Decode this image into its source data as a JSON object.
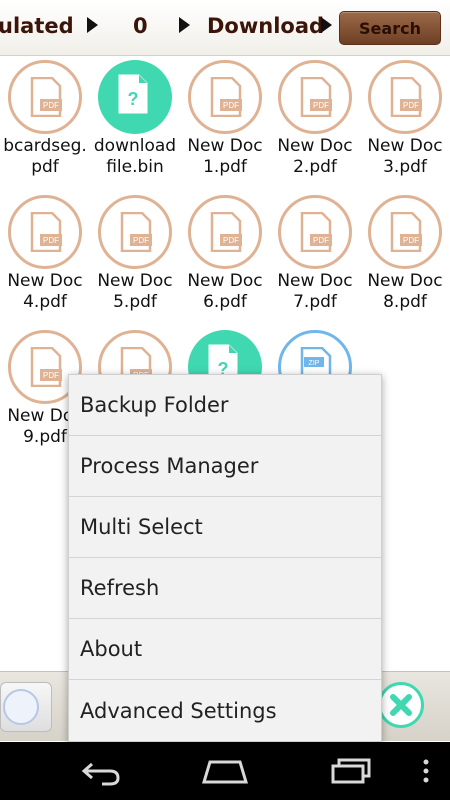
{
  "breadcrumb": {
    "items": [
      "ulated",
      "0",
      "Download"
    ],
    "search_label": "Search"
  },
  "files": [
    {
      "name_line1": "bcardseg.",
      "name_line2": "pdf",
      "type": "pdf-icon"
    },
    {
      "name_line1": "download",
      "name_line2": "file.bin",
      "type": "bin-icon"
    },
    {
      "name_line1": "New Doc",
      "name_line2": "1.pdf",
      "type": "pdf-icon"
    },
    {
      "name_line1": "New Doc",
      "name_line2": "2.pdf",
      "type": "pdf-icon"
    },
    {
      "name_line1": "New Doc",
      "name_line2": "3.pdf",
      "type": "pdf-icon"
    },
    {
      "name_line1": "New Doc",
      "name_line2": "4.pdf",
      "type": "pdf-icon"
    },
    {
      "name_line1": "New Doc",
      "name_line2": "5.pdf",
      "type": "pdf-icon"
    },
    {
      "name_line1": "New Doc",
      "name_line2": "6.pdf",
      "type": "pdf-icon"
    },
    {
      "name_line1": "New Doc",
      "name_line2": "7.pdf",
      "type": "pdf-icon"
    },
    {
      "name_line1": "New Doc",
      "name_line2": "8.pdf",
      "type": "pdf-icon"
    },
    {
      "name_line1": "New Doc",
      "name_line2": "9.pdf",
      "type": "pdf-icon"
    },
    {
      "name_line1": "",
      "name_line2": "",
      "type": "pdf-icon"
    },
    {
      "name_line1": "",
      "name_line2": "",
      "type": "bin-icon"
    },
    {
      "name_line1": "",
      "name_line2": "",
      "type": "zip-icon"
    }
  ],
  "icon_labels": {
    "pdf": "PDF",
    "zip": "ZIP",
    "bin": "?"
  },
  "menu": {
    "items": [
      "Backup Folder",
      "Process Manager",
      "Multi Select",
      "Refresh",
      "About",
      "Advanced Settings"
    ]
  },
  "colors": {
    "pdf_ring": "#e0b294",
    "bin_fill": "#3fd8b0",
    "zip_ring": "#6fb6ea",
    "search_button": "#7a4a2c",
    "breadcrumb_text": "#3a1508"
  },
  "navbar": {
    "icons": [
      "back-icon",
      "home-icon",
      "recent-apps-icon",
      "overflow-menu-icon"
    ]
  }
}
